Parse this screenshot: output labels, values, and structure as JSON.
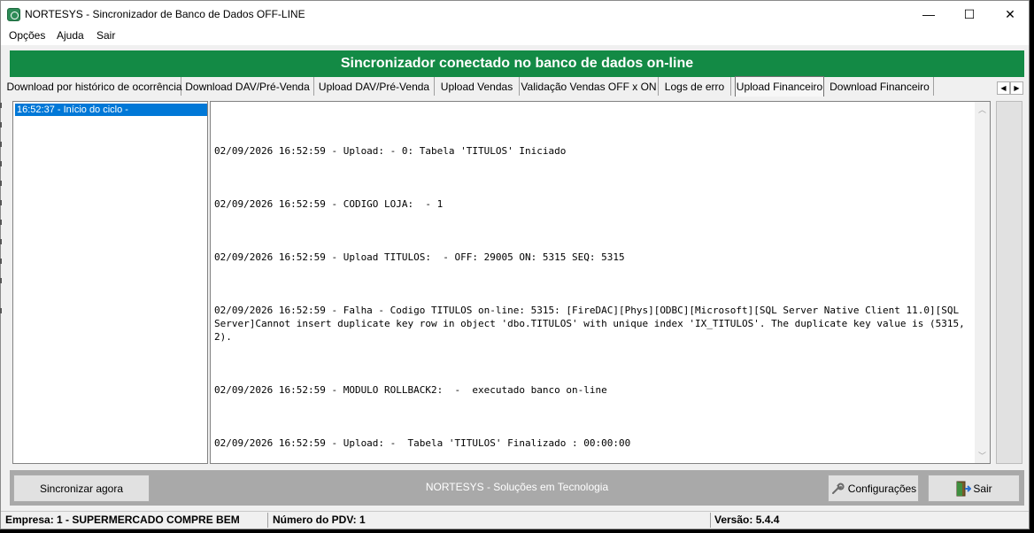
{
  "window": {
    "title": "NORTESYS - Sincronizador de Banco de Dados OFF-LINE",
    "minimize": "—",
    "maximize": "☐",
    "close": "✕"
  },
  "menu": {
    "items": [
      "Opções",
      "Ajuda",
      "Sair"
    ]
  },
  "banner": {
    "text": "Sincronizador conectado no banco de dados on-line",
    "color": "#138a45"
  },
  "tabs": {
    "items": [
      {
        "label": "Download por histórico de ocorrência"
      },
      {
        "label": "Download DAV/Pré-Venda"
      },
      {
        "label": "Upload DAV/Pré-Venda"
      },
      {
        "label": "Upload Vendas"
      },
      {
        "label": "Validação Vendas OFF x ON"
      },
      {
        "label": "Logs de erro"
      },
      {
        "label": "Upload Financeiro"
      },
      {
        "label": "Download Financeiro"
      }
    ],
    "active": "Upload Financeiro",
    "scroll_left": "◀",
    "scroll_right": "▶"
  },
  "cycle_list": {
    "items": [
      "16:52:37 - Início do ciclo -"
    ],
    "selected_color": "#0078d7"
  },
  "log": {
    "lines": [
      "02/09/2026 16:52:59 - Upload: - 0: Tabela 'TITULOS' Iniciado",
      "02/09/2026 16:52:59 - CODIGO LOJA:  - 1",
      "02/09/2026 16:52:59 - Upload TITULOS:  - OFF: 29005 ON: 5315 SEQ: 5315",
      "02/09/2026 16:52:59 - Falha - Codigo TITULOS on-line: 5315: [FireDAC][Phys][ODBC][Microsoft][SQL Server Native Client 11.0][SQL Server]Cannot insert duplicate key row in object 'dbo.TITULOS' with unique index 'IX_TITULOS'. The duplicate key value is (5315, 2).",
      "02/09/2026 16:52:59 - MODULO ROLLBACK2:  -  executado banco on-line",
      "02/09/2026 16:52:59 - Upload: -  Tabela 'TITULOS' Finalizado : 00:00:00"
    ],
    "scroll_up": "︿",
    "scroll_down": "﹀"
  },
  "bottom": {
    "sync_button": "Sincronizar agora",
    "footer_text": "NORTESYS - Soluções em Tecnologia",
    "config_button": "Configurações",
    "exit_button": "Sair"
  },
  "status": {
    "empresa": "Empresa: 1 - SUPERMERCADO COMPRE BEM",
    "pdv": "Número do PDV: 1",
    "versao": "Versão: 5.4.4"
  }
}
